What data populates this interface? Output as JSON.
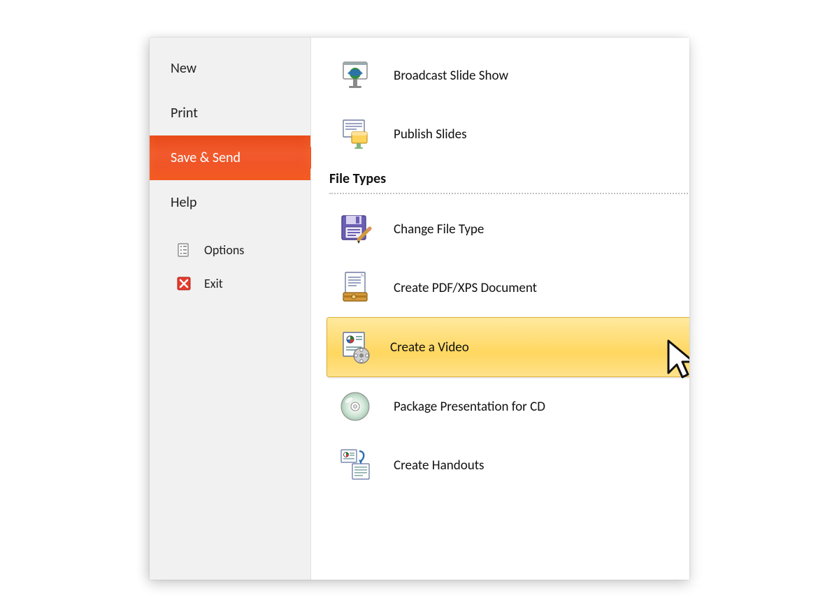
{
  "sidebar": {
    "items": [
      {
        "label": "New",
        "selected": false
      },
      {
        "label": "Print",
        "selected": false
      },
      {
        "label": "Save & Send",
        "selected": true
      },
      {
        "label": "Help",
        "selected": false
      }
    ],
    "options_label": "Options",
    "exit_label": "Exit"
  },
  "main": {
    "top_options": [
      {
        "label": "Broadcast Slide Show"
      },
      {
        "label": "Publish Slides"
      }
    ],
    "section_title": "File Types",
    "file_type_options": [
      {
        "label": "Change File Type",
        "highlight": false
      },
      {
        "label": "Create PDF/XPS Document",
        "highlight": false
      },
      {
        "label": "Create a Video",
        "highlight": true
      },
      {
        "label": "Package Presentation for CD",
        "highlight": false
      },
      {
        "label": "Create Handouts",
        "highlight": false
      }
    ]
  },
  "colors": {
    "accent_orange": "#ef4f20",
    "highlight_yellow": "#ffd760",
    "sidebar_bg": "#f1f1f1"
  }
}
